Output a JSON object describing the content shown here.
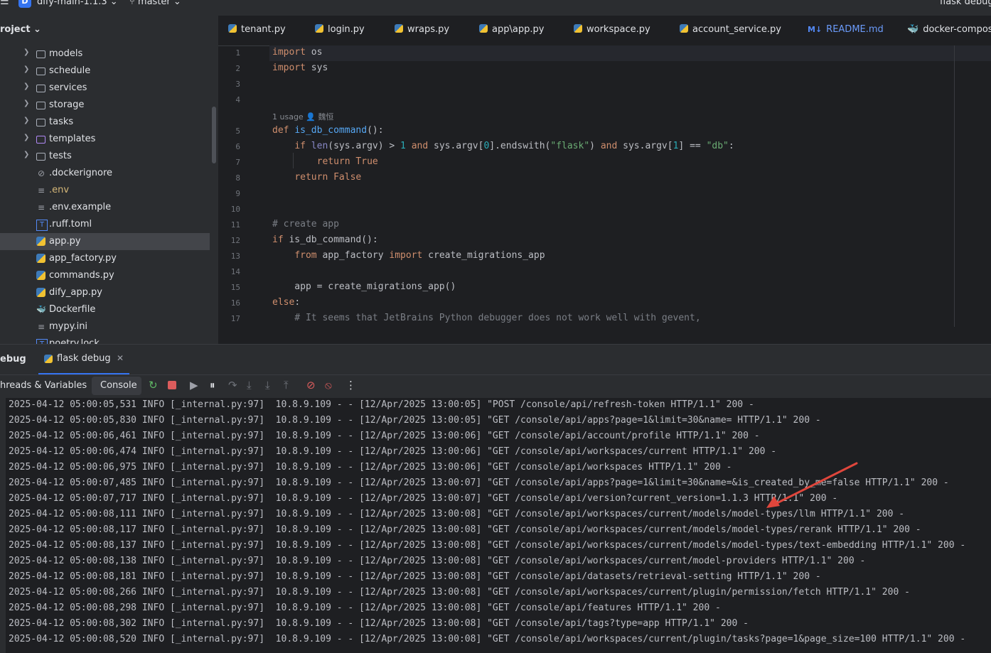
{
  "titlebar": {
    "project_initial": "D",
    "project_name": "dify-main-1.1.3 ⌄",
    "branch": "⑂ master ⌄",
    "run_config": "flask debug"
  },
  "project_panel": {
    "header": "roject ⌄",
    "items": [
      {
        "label": "models",
        "kind": "folder",
        "expandable": true
      },
      {
        "label": "schedule",
        "kind": "folder",
        "expandable": true
      },
      {
        "label": "services",
        "kind": "folder",
        "expandable": true
      },
      {
        "label": "storage",
        "kind": "folder",
        "expandable": true
      },
      {
        "label": "tasks",
        "kind": "folder",
        "expandable": true
      },
      {
        "label": "templates",
        "kind": "folder-purple",
        "expandable": true
      },
      {
        "label": "tests",
        "kind": "folder",
        "expandable": true
      },
      {
        "label": ".dockerignore",
        "kind": "ignore"
      },
      {
        "label": ".env",
        "kind": "text",
        "color": "#d5b778"
      },
      {
        "label": ".env.example",
        "kind": "text"
      },
      {
        "label": ".ruff.toml",
        "kind": "toml"
      },
      {
        "label": "app.py",
        "kind": "python",
        "selected": true
      },
      {
        "label": "app_factory.py",
        "kind": "python"
      },
      {
        "label": "commands.py",
        "kind": "python"
      },
      {
        "label": "dify_app.py",
        "kind": "python"
      },
      {
        "label": "Dockerfile",
        "kind": "docker"
      },
      {
        "label": "mypy.ini",
        "kind": "ini"
      },
      {
        "label": "poetry.lock",
        "kind": "lock"
      }
    ]
  },
  "editor": {
    "tabs": [
      {
        "label": "tenant.py",
        "kind": "python"
      },
      {
        "label": "login.py",
        "kind": "python"
      },
      {
        "label": "wraps.py",
        "kind": "python"
      },
      {
        "label": "app\\app.py",
        "kind": "python"
      },
      {
        "label": "workspace.py",
        "kind": "python"
      },
      {
        "label": "account_service.py",
        "kind": "python"
      },
      {
        "label": "README.md",
        "kind": "markdown",
        "icon_text": "M↓"
      },
      {
        "label": "docker-compos",
        "kind": "docker"
      }
    ],
    "line_numbers": [
      "1",
      "2",
      "3",
      "4",
      "5",
      "6",
      "7",
      "8",
      "9",
      "10",
      "11",
      "12",
      "13",
      "14",
      "15",
      "16",
      "17"
    ],
    "inlay_hint": "1 usage   👤 魏恒",
    "code_lines": [
      "import os",
      "import sys",
      "",
      "",
      "def is_db_command():",
      "    if len(sys.argv) > 1 and sys.argv[0].endswith(\"flask\") and sys.argv[1] == \"db\":",
      "        return True",
      "    return False",
      "",
      "",
      "# create app",
      "if is_db_command():",
      "    from app_factory import create_migrations_app",
      "",
      "    app = create_migrations_app()",
      "else:",
      "    # It seems that JetBrains Python debugger does not work well with gevent,"
    ]
  },
  "debug": {
    "title": "ebug",
    "run_tab": "flask debug",
    "subtabs": [
      "hreads & Variables",
      "Console"
    ],
    "toolbar_icons": [
      "rerun-icon",
      "stop-icon",
      "resume-icon",
      "pause-icon",
      "step-over-icon",
      "step-into-icon",
      "force-step-into-icon",
      "step-out-icon",
      "view-breakpoints-icon",
      "mute-breakpoints-icon",
      "more-icon"
    ],
    "log_lines": [
      "2025-04-12 05:00:05,531 INFO [_internal.py:97]  10.8.9.109 - - [12/Apr/2025 13:00:05] \"POST /console/api/refresh-token HTTP/1.1\" 200 -",
      "2025-04-12 05:00:05,830 INFO [_internal.py:97]  10.8.9.109 - - [12/Apr/2025 13:00:05] \"GET /console/api/apps?page=1&limit=30&name= HTTP/1.1\" 200 -",
      "2025-04-12 05:00:06,461 INFO [_internal.py:97]  10.8.9.109 - - [12/Apr/2025 13:00:06] \"GET /console/api/account/profile HTTP/1.1\" 200 -",
      "2025-04-12 05:00:06,474 INFO [_internal.py:97]  10.8.9.109 - - [12/Apr/2025 13:00:06] \"GET /console/api/workspaces/current HTTP/1.1\" 200 -",
      "2025-04-12 05:00:06,975 INFO [_internal.py:97]  10.8.9.109 - - [12/Apr/2025 13:00:06] \"GET /console/api/workspaces HTTP/1.1\" 200 -",
      "2025-04-12 05:00:07,485 INFO [_internal.py:97]  10.8.9.109 - - [12/Apr/2025 13:00:07] \"GET /console/api/apps?page=1&limit=30&name=&is_created_by_me=false HTTP/1.1\" 200 -",
      "2025-04-12 05:00:07,717 INFO [_internal.py:97]  10.8.9.109 - - [12/Apr/2025 13:00:07] \"GET /console/api/version?current_version=1.1.3 HTTP/1.1\" 200 -",
      "2025-04-12 05:00:08,111 INFO [_internal.py:97]  10.8.9.109 - - [12/Apr/2025 13:00:08] \"GET /console/api/workspaces/current/models/model-types/llm HTTP/1.1\" 200 -",
      "2025-04-12 05:00:08,117 INFO [_internal.py:97]  10.8.9.109 - - [12/Apr/2025 13:00:08] \"GET /console/api/workspaces/current/models/model-types/rerank HTTP/1.1\" 200 -",
      "2025-04-12 05:00:08,137 INFO [_internal.py:97]  10.8.9.109 - - [12/Apr/2025 13:00:08] \"GET /console/api/workspaces/current/models/model-types/text-embedding HTTP/1.1\" 200 -",
      "2025-04-12 05:00:08,138 INFO [_internal.py:97]  10.8.9.109 - - [12/Apr/2025 13:00:08] \"GET /console/api/workspaces/current/model-providers HTTP/1.1\" 200 -",
      "2025-04-12 05:00:08,181 INFO [_internal.py:97]  10.8.9.109 - - [12/Apr/2025 13:00:08] \"GET /console/api/datasets/retrieval-setting HTTP/1.1\" 200 -",
      "2025-04-12 05:00:08,266 INFO [_internal.py:97]  10.8.9.109 - - [12/Apr/2025 13:00:08] \"GET /console/api/workspaces/current/plugin/permission/fetch HTTP/1.1\" 200 -",
      "2025-04-12 05:00:08,298 INFO [_internal.py:97]  10.8.9.109 - - [12/Apr/2025 13:00:08] \"GET /console/api/features HTTP/1.1\" 200 -",
      "2025-04-12 05:00:08,302 INFO [_internal.py:97]  10.8.9.109 - - [12/Apr/2025 13:00:08] \"GET /console/api/tags?type=app HTTP/1.1\" 200 -",
      "2025-04-12 05:00:08,520 INFO [_internal.py:97]  10.8.9.109 - - [12/Apr/2025 13:00:08] \"GET /console/api/workspaces/current/plugin/tasks?page=1&page_size=100 HTTP/1.1\" 200 -"
    ]
  },
  "annotation": {
    "kind": "red-arrow",
    "color": "#e0463c",
    "points_at": "version?current_version=1.1.3"
  }
}
